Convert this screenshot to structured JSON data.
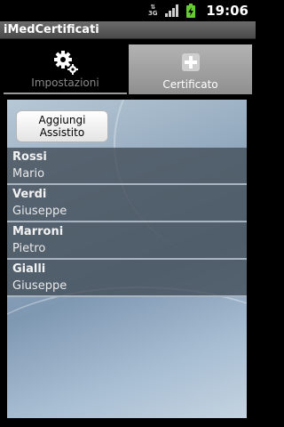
{
  "status_bar": {
    "data_indicator": "3G",
    "time": "19:06",
    "icons": [
      "data-3g-icon",
      "signal-icon",
      "battery-charging-icon"
    ]
  },
  "app": {
    "title": "iMedCertificati"
  },
  "tabs": [
    {
      "label": "Impostazioni",
      "icon": "gear-icon",
      "selected": false
    },
    {
      "label": "Certificato",
      "icon": "plus-icon",
      "selected": true
    }
  ],
  "main": {
    "add_button_label": "Aggiungi Assistito",
    "patients": [
      {
        "surname": "Rossi",
        "name": "Mario"
      },
      {
        "surname": "Verdi",
        "name": "Giuseppe"
      },
      {
        "surname": "Marroni",
        "name": "Pietro"
      },
      {
        "surname": "Gialli",
        "name": "Giuseppe"
      }
    ]
  },
  "colors": {
    "accent_battery": "#66cc33",
    "list_background": "#46505c",
    "tab_selected": "#a8a8a8"
  }
}
